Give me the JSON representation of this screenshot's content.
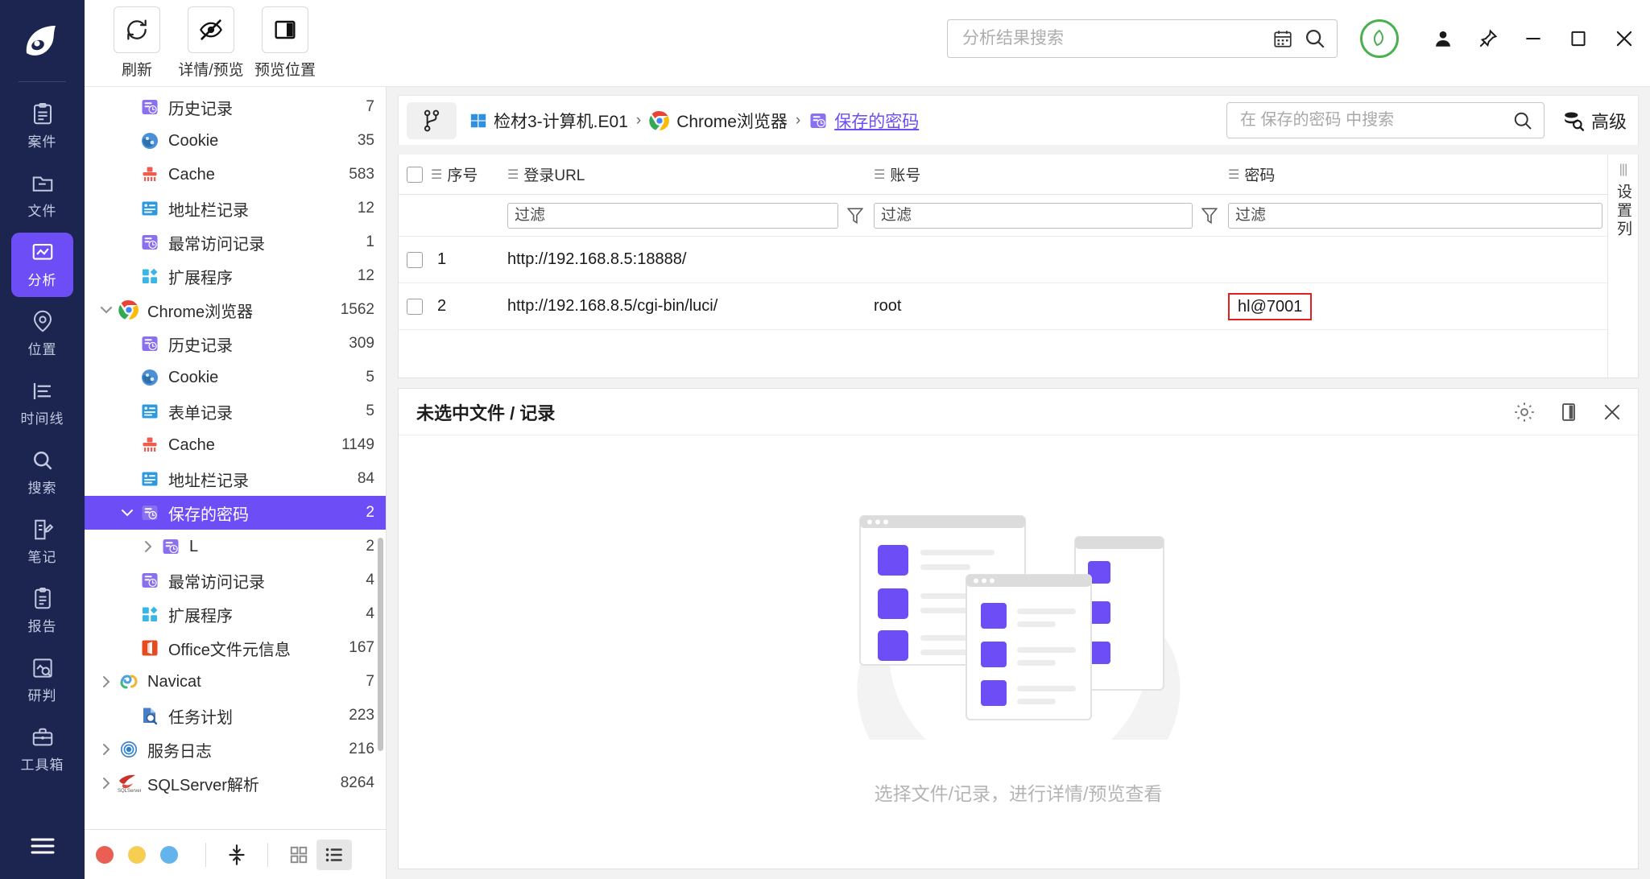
{
  "toolbar": {
    "buttons": [
      {
        "label": "刷新",
        "icon": "refresh-icon"
      },
      {
        "label": "详情/预览",
        "icon": "eye-off-icon"
      },
      {
        "label": "预览位置",
        "icon": "panel-layout-icon"
      }
    ]
  },
  "global_search": {
    "placeholder": "分析结果搜索",
    "value": "",
    "calendar_icon": "calendar-icon",
    "search_icon": "search-icon"
  },
  "window_controls": {
    "badge_icon": "leaf-badge-icon",
    "user_icon": "user-icon",
    "pin_icon": "pin-icon",
    "minimize": "minimize-icon",
    "maximize": "maximize-icon",
    "close": "close-icon"
  },
  "rail": {
    "logo": "app-logo",
    "items": [
      {
        "label": "案件",
        "icon": "case-icon",
        "active": false
      },
      {
        "label": "文件",
        "icon": "folder-icon",
        "active": false
      },
      {
        "label": "分析",
        "icon": "analysis-icon",
        "active": true
      },
      {
        "label": "位置",
        "icon": "location-icon",
        "active": false
      },
      {
        "label": "时间线",
        "icon": "timeline-icon",
        "active": false
      },
      {
        "label": "搜索",
        "icon": "search-icon",
        "active": false
      },
      {
        "label": "笔记",
        "icon": "note-icon",
        "active": false
      },
      {
        "label": "报告",
        "icon": "report-icon",
        "active": false
      },
      {
        "label": "研判",
        "icon": "investigate-icon",
        "active": false
      },
      {
        "label": "工具箱",
        "icon": "toolbox-icon",
        "active": false
      }
    ],
    "menu_icon": "hamburger-menu-icon",
    "active_color": "#6c4df6"
  },
  "tree": {
    "nodes": [
      {
        "label": "历史记录",
        "count": "7",
        "icon": "history-icon",
        "indent": 2,
        "arrow": "none",
        "selected": false
      },
      {
        "label": "Cookie",
        "count": "35",
        "icon": "cookie-icon",
        "indent": 2,
        "arrow": "none",
        "selected": false
      },
      {
        "label": "Cache",
        "count": "583",
        "icon": "cache-icon",
        "indent": 2,
        "arrow": "none",
        "selected": false
      },
      {
        "label": "地址栏记录",
        "count": "12",
        "icon": "address-icon",
        "indent": 2,
        "arrow": "none",
        "selected": false
      },
      {
        "label": "最常访问记录",
        "count": "1",
        "icon": "history-icon",
        "indent": 2,
        "arrow": "none",
        "selected": false
      },
      {
        "label": "扩展程序",
        "count": "12",
        "icon": "extension-icon",
        "indent": 2,
        "arrow": "none",
        "selected": false
      },
      {
        "label": "Chrome浏览器",
        "count": "1562",
        "icon": "chrome-icon",
        "indent": 1,
        "arrow": "expanded",
        "selected": false
      },
      {
        "label": "历史记录",
        "count": "309",
        "icon": "history-icon",
        "indent": 2,
        "arrow": "none",
        "selected": false
      },
      {
        "label": "Cookie",
        "count": "5",
        "icon": "cookie-icon",
        "indent": 2,
        "arrow": "none",
        "selected": false
      },
      {
        "label": "表单记录",
        "count": "5",
        "icon": "address-icon",
        "indent": 2,
        "arrow": "none",
        "selected": false
      },
      {
        "label": "Cache",
        "count": "1149",
        "icon": "cache-icon",
        "indent": 2,
        "arrow": "none",
        "selected": false
      },
      {
        "label": "地址栏记录",
        "count": "84",
        "icon": "address-icon",
        "indent": 2,
        "arrow": "none",
        "selected": false
      },
      {
        "label": "保存的密码",
        "count": "2",
        "icon": "history-icon",
        "indent": 2,
        "arrow": "expanded",
        "selected": true
      },
      {
        "label": "L",
        "count": "2",
        "icon": "history-icon",
        "indent": 3,
        "arrow": "collapsed",
        "selected": false
      },
      {
        "label": "最常访问记录",
        "count": "4",
        "icon": "history-icon",
        "indent": 2,
        "arrow": "none",
        "selected": false
      },
      {
        "label": "扩展程序",
        "count": "4",
        "icon": "extension-icon",
        "indent": 2,
        "arrow": "none",
        "selected": false
      },
      {
        "label": "Office文件元信息",
        "count": "167",
        "icon": "office-icon",
        "indent": 2,
        "arrow": "none",
        "selected": false
      },
      {
        "label": "Navicat",
        "count": "7",
        "icon": "navicat-icon",
        "indent": 1,
        "arrow": "collapsed",
        "selected": false
      },
      {
        "label": "任务计划",
        "count": "223",
        "icon": "task-icon",
        "indent": 2,
        "arrow": "none",
        "selected": false
      },
      {
        "label": "服务日志",
        "count": "216",
        "icon": "service-icon",
        "indent": 1,
        "arrow": "collapsed",
        "selected": false
      },
      {
        "label": "SQLServer解析",
        "count": "8264",
        "icon": "sqlserver-icon",
        "indent": 1,
        "arrow": "collapsed",
        "selected": false
      }
    ],
    "footer": {
      "dots": [
        "#e95f53",
        "#f7ce54",
        "#63b3ed"
      ],
      "sort_icon": "sort-updown-icon",
      "grid_icon": "grid-view-icon",
      "list_icon": "list-view-icon",
      "active_view": "list"
    }
  },
  "breadcrumb": {
    "branch_icon": "branch-icon",
    "items": [
      {
        "label": "检材3-计算机.E01",
        "icon": "windows-icon"
      },
      {
        "label": "Chrome浏览器",
        "icon": "chrome-icon"
      },
      {
        "label": "保存的密码",
        "icon": "history-icon"
      }
    ],
    "separator": "›"
  },
  "local_search": {
    "placeholder": "在 保存的密码 中搜索",
    "value": "",
    "search_icon": "search-icon"
  },
  "advanced": {
    "label": "高级",
    "icon": "advanced-search-icon"
  },
  "table": {
    "columns": [
      {
        "key": "idx",
        "label": "序号"
      },
      {
        "key": "url",
        "label": "登录URL"
      },
      {
        "key": "acct",
        "label": "账号"
      },
      {
        "key": "pwd",
        "label": "密码"
      }
    ],
    "filter_placeholder": "过滤",
    "filters": {
      "url": "",
      "acct": "",
      "pwd": ""
    },
    "rows": [
      {
        "idx": "1",
        "url": "http://192.168.8.5:18888/",
        "acct": "",
        "pwd": "",
        "checked": false,
        "pwd_highlight": false
      },
      {
        "idx": "2",
        "url": "http://192.168.8.5/cgi-bin/luci/",
        "acct": "root",
        "pwd": "hl@7001",
        "checked": false,
        "pwd_highlight": true
      }
    ],
    "side_panel_label": "设置列",
    "highlight_color": "#e02020"
  },
  "preview": {
    "title": "未选中文件 / 记录",
    "hint": "选择文件/记录，进行详情/预览查看",
    "gear_icon": "gear-icon",
    "layout_icon": "panel-layout-icon",
    "close_icon": "close-icon"
  }
}
